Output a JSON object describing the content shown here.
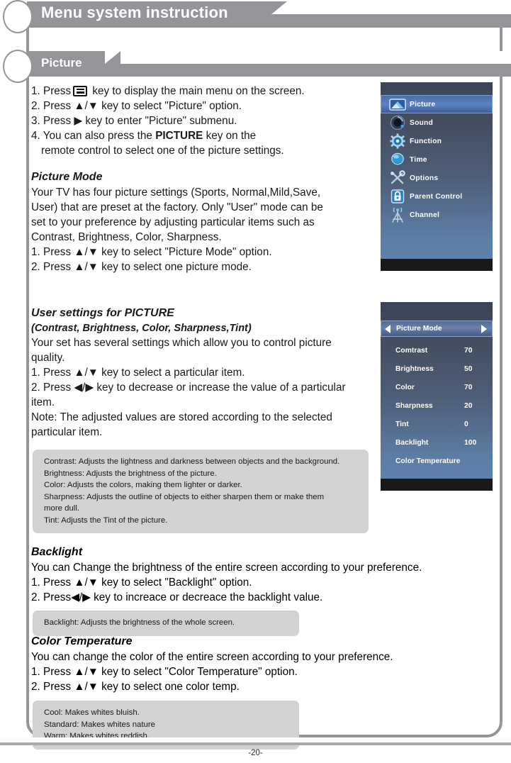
{
  "header": {
    "title": "Menu system instruction",
    "section": "Picture"
  },
  "steps_main": [
    {
      "pre": "1. Press",
      "icon": "menu-key-icon",
      "post": "key to display the main menu on the screen."
    },
    {
      "text": "2. Press ▲/▼ key to select \"Picture\" option."
    },
    {
      "text": "3. Press ▶ key to enter \"Picture\" submenu."
    },
    {
      "text": "4. You can also press the PICTURE key on the"
    },
    {
      "text": "remote control to select one of the picture settings."
    }
  ],
  "picture_mode": {
    "heading": "Picture Mode",
    "body": [
      "Your TV has four picture settings (Sports, Normal,Mild,Save,",
      "User) that are preset at the factory. Only \"User\" mode can be",
      "set to your preference by adjusting particular items such as",
      "Contrast, Brightness, Color, Sharpness.",
      "1. Press ▲/▼ key to select \"Picture Mode\" option.",
      "2. Press ▲/▼ key to select one picture mode."
    ]
  },
  "user_settings": {
    "heading": "User settings for PICTURE",
    "subheading": "(Contrast, Brightness, Color, Sharpness,Tint)",
    "body": [
      "Your set has several settings which allow you to control picture",
      " quality.",
      "1. Press ▲/▼  key to select a particular item.",
      "2. Press ◀/▶ key to decrease or increase the value of a particular",
      " item.",
      "Note: The adjusted values are stored according to the selected",
      "particular item."
    ],
    "note": [
      "Contrast: Adjusts the lightness and darkness between objects and the background.",
      "Brightness: Adjusts the brightness of the picture.",
      "Color: Adjusts the colors, making them lighter or darker.",
      "Sharpness: Adjusts the outline of objects to either sharpen them or make them",
      "more dull.",
      "Tint: Adjusts the Tint of the picture."
    ]
  },
  "backlight": {
    "heading": "Backlight",
    "body": [
      "You can Change the brightness of the entire screen according to your preference.",
      "1. Press ▲/▼ key to select \"Backlight\" option.",
      "2. Press◀/▶ key to increace or decreace the backlight value."
    ],
    "note": [
      "Backlight: Adjusts the brightness of the whole screen."
    ]
  },
  "color_temperature": {
    "heading": "Color Temperature",
    "body": [
      "You can change the color of the entire screen  according to your preference.",
      "1. Press ▲/▼ key to select \"Color Temperature\" option.",
      "2. Press ▲/▼ key to select one color temp."
    ],
    "note": [
      "Cool: Makes whites bluish.",
      "Standard: Makes whites nature",
      "Warm: Makes whites reddish."
    ]
  },
  "osd_main_menu": {
    "items": [
      {
        "label": "Picture",
        "icon": "picture-icon",
        "selected": true
      },
      {
        "label": "Sound",
        "icon": "speaker-icon",
        "selected": false
      },
      {
        "label": "Function",
        "icon": "gear-icon",
        "selected": false
      },
      {
        "label": "Time",
        "icon": "clock-icon",
        "selected": false
      },
      {
        "label": "Options",
        "icon": "tools-icon",
        "selected": false
      },
      {
        "label": "Parent  Control",
        "icon": "lock-icon",
        "selected": false
      },
      {
        "label": "Channel",
        "icon": "antenna-icon",
        "selected": false
      }
    ]
  },
  "osd_picture_menu": {
    "header": "Picture Mode",
    "rows": [
      {
        "name": "Comtrast",
        "value": "70"
      },
      {
        "name": "Brightness",
        "value": "50"
      },
      {
        "name": "Color",
        "value": "70"
      },
      {
        "name": "Sharpness",
        "value": "20"
      },
      {
        "name": "Tint",
        "value": "0"
      },
      {
        "name": "Backlight",
        "value": "100"
      },
      {
        "name": "Color Temperature",
        "value": ""
      }
    ]
  },
  "footer": {
    "page": "-20-"
  },
  "colors": {
    "tab_gray": "#939598",
    "note_gray": "#d0d2d4",
    "osd_top": "#3c4556",
    "osd_bottom": "#5e80ab",
    "osd_highlight": "#5b82c3",
    "frame": "#939598"
  }
}
